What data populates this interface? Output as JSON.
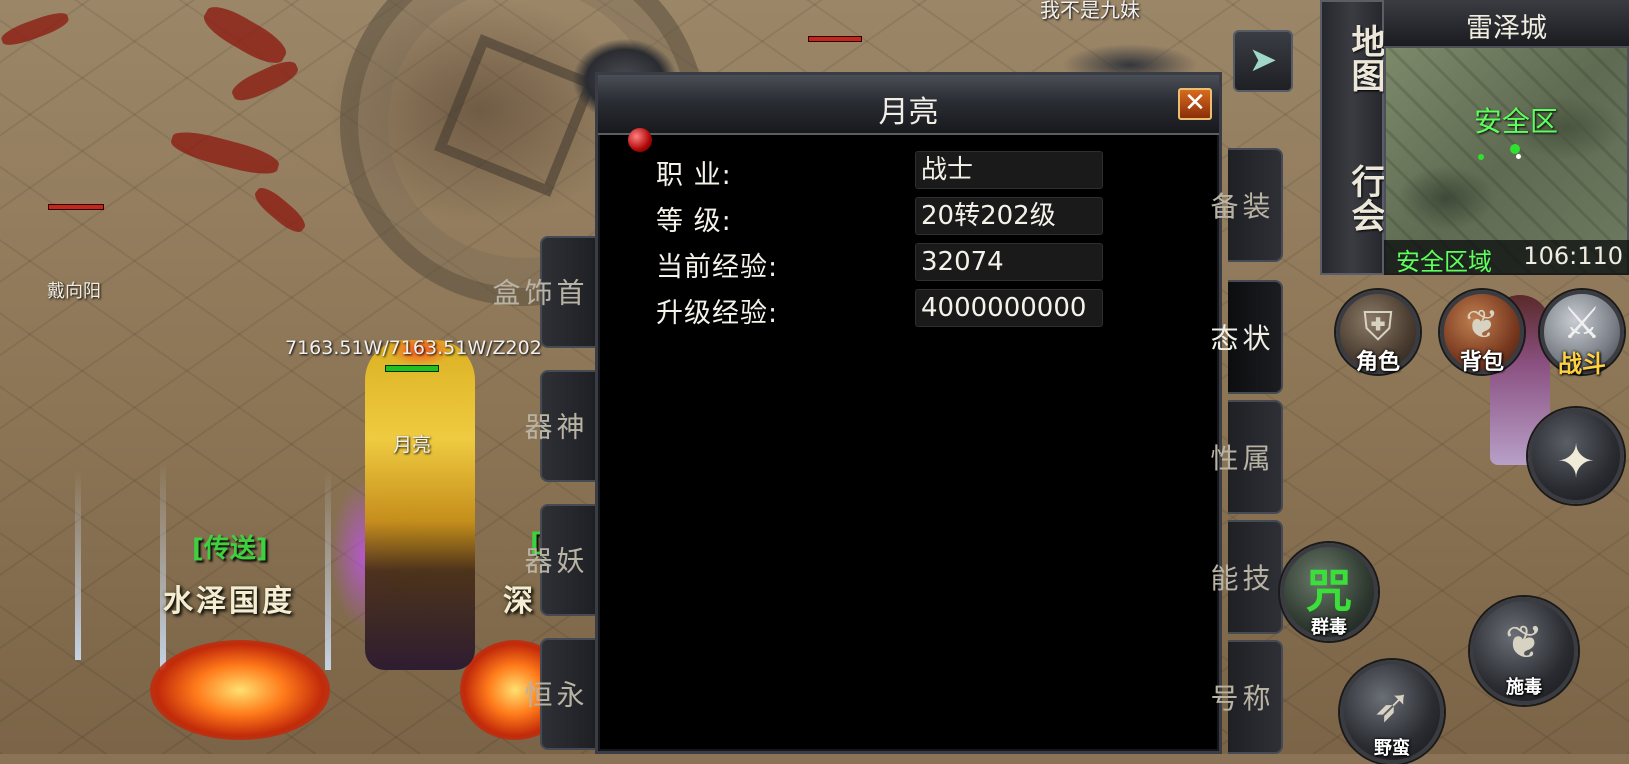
{
  "world": {
    "top_player_name": "我不是九妹",
    "npc_name": "戴向阳",
    "hero": {
      "hp_text": "7163.51W/7163.51W/Z202",
      "name": "月亮"
    },
    "teleports": [
      {
        "tag": "[传送]",
        "place": "水泽国度"
      },
      {
        "tag": "[",
        "place": "深"
      }
    ]
  },
  "dialog": {
    "title": "月亮",
    "close_glyph": "✕",
    "stats": [
      {
        "label": "职  业:",
        "value": "战士"
      },
      {
        "label": "等  级:",
        "value": "20转202级"
      },
      {
        "label": "当前经验:",
        "value": "32074"
      },
      {
        "label": "升级经验:",
        "value": "4000000000"
      }
    ],
    "left_tabs": [
      "首饰盒",
      "神器",
      "妖器",
      "永恒"
    ],
    "right_tabs": [
      "装备",
      "状态",
      "属性",
      "技能",
      "称号"
    ],
    "active_right_tab": "状态"
  },
  "minimap": {
    "side_buttons": [
      "地图",
      "行会"
    ],
    "title": "雷泽城",
    "zone_label": "安全区",
    "area_name": "安全区域",
    "coords": "106:110"
  },
  "hud": {
    "collapse_icon": "collapse-arrow-icon",
    "menu_buttons": [
      {
        "label": "角色",
        "icon": "helmet-icon"
      },
      {
        "label": "背包",
        "icon": "bag-icon"
      },
      {
        "label": "战斗",
        "icon": "crossed-swords-icon"
      }
    ],
    "skills": [
      {
        "label": "群毒",
        "glyph": "咒"
      },
      {
        "label": "野蛮",
        "glyph": "➶"
      },
      {
        "label": "施毒",
        "glyph": "❦"
      }
    ],
    "action_icon": "shuriken-icon"
  },
  "colors": {
    "accent_green": "#5dff5d",
    "close_button": "#c2511a",
    "dialog_bg": "#000000"
  }
}
